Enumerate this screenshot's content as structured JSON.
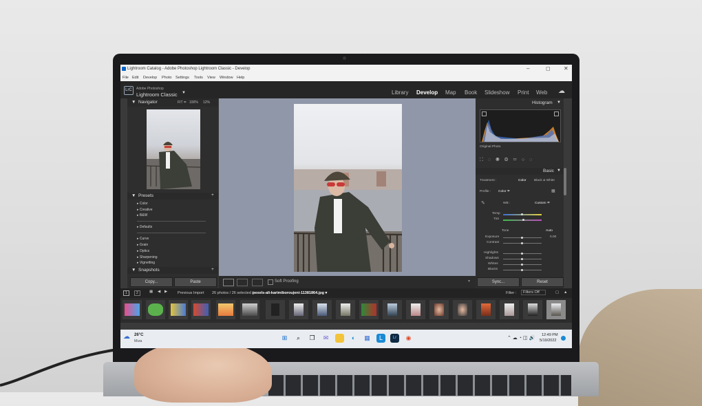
{
  "window": {
    "title": "Lightroom Catalog - Adobe Photoshop Lightroom Classic - Develop",
    "controls": [
      "–",
      "◻",
      "✕"
    ]
  },
  "menubar": [
    "File",
    "Edit",
    "Develop",
    "Photo",
    "Settings",
    "Tools",
    "View",
    "Window",
    "Help"
  ],
  "brand": {
    "line1": "Adobe Photoshop",
    "line2": "Lightroom Classic",
    "logo": "LrC"
  },
  "modules": [
    {
      "label": "Library",
      "active": false
    },
    {
      "label": "Develop",
      "active": true
    },
    {
      "label": "Map",
      "active": false
    },
    {
      "label": "Book",
      "active": false
    },
    {
      "label": "Slideshow",
      "active": false
    },
    {
      "label": "Print",
      "active": false
    },
    {
      "label": "Web",
      "active": false
    }
  ],
  "navigator": {
    "title": "Navigator",
    "zoom": [
      "FIT ≑",
      "100%",
      "12%"
    ]
  },
  "presets": {
    "title": "Presets",
    "items": [
      "Color",
      "Creative",
      "B&W",
      "Defaults",
      "Curve",
      "Grain",
      "Optics",
      "Sharpening",
      "Vignetting"
    ]
  },
  "snapshots": {
    "title": "Snapshots"
  },
  "left_buttons": {
    "copy": "Copy...",
    "paste": "Paste"
  },
  "toolbar": {
    "soft_proofing": "Soft Proofing"
  },
  "histogram": {
    "title": "Histogram",
    "original_photo": "Original Photo"
  },
  "basic": {
    "title": "Basic",
    "treatment_label": "Treatment :",
    "treatment_color": "Color",
    "treatment_bw": "Black & White",
    "profile_label": "Profile :",
    "profile_value": "Color ≑",
    "wb_label": "WB :",
    "wb_value": "Custom ≑",
    "temp": "Temp",
    "tint": "Tint",
    "tone": "Tone",
    "auto": "Auto",
    "exposure": "Exposure",
    "exposure_value": "0.00",
    "contrast": "Contrast",
    "highlights": "Highlights",
    "shadows": "Shadows",
    "whites": "Whites",
    "blacks": "Blacks"
  },
  "right_buttons": {
    "sync": "Sync...",
    "reset": "Reset"
  },
  "filmstrip": {
    "view_1": "1",
    "view_2": "2",
    "source": "Previous Import",
    "count": "26 photos / 26 selected /",
    "filename": "pexels-ali-karimiboroujeni-11381864.jpg ▾",
    "filter_label": "Filter :",
    "filter_value": "Filters Off"
  },
  "taskbar": {
    "weather_temp": "26°C",
    "weather_desc": "Mưa",
    "time": "12:49 PM",
    "date": "5/19/2022"
  },
  "colors": {
    "accent_blue": "#0a64c8",
    "lr_bg": "#3a3a3a",
    "canvas": "#8f97a8"
  }
}
